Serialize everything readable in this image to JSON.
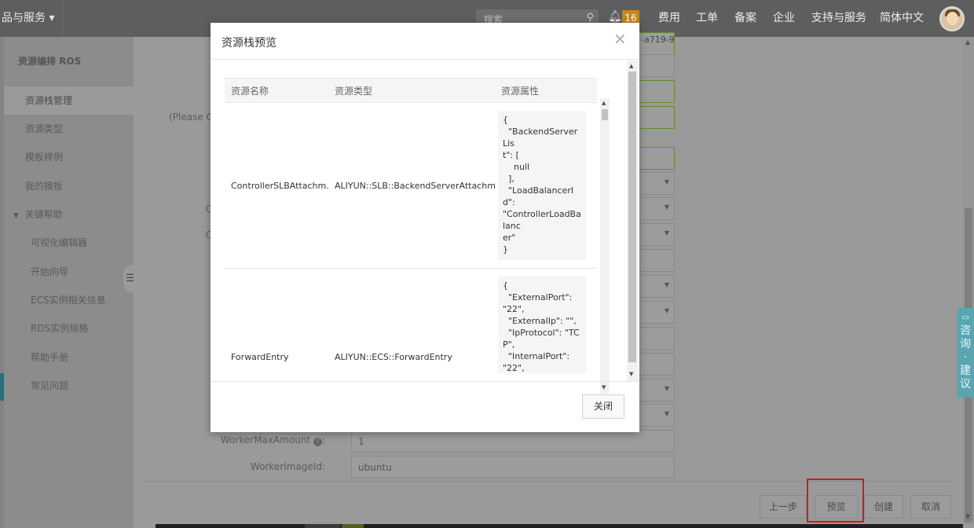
{
  "topbar": {
    "product_menu": "品与服务 ▾",
    "search_placeholder": "搜索",
    "notifications": "16",
    "nav": [
      "费用",
      "工单",
      "备案",
      "企业",
      "支持与服务",
      "简体中文"
    ]
  },
  "sidebar": {
    "title": "资源编排 ROS",
    "items": [
      "资源栈管理",
      "资源类型",
      "模板样例",
      "我的模板"
    ],
    "group": "关键帮助",
    "subitems": [
      "可视化编辑器",
      "开始向导",
      "ECS实例相关信息",
      "RDS实例规格",
      "帮助手册",
      "常见问题"
    ]
  },
  "form": {
    "hint_text": "(Please Co",
    "top_value": "-a719-9",
    "worker_max_label": "WorkerMaxAmount",
    "worker_max_value": "1",
    "worker_image_label": "WorkerImageId:",
    "worker_image_value": "ubuntu",
    "c_label_1": "C",
    "c_label_2": "C"
  },
  "footer": {
    "prev": "上一步",
    "preview": "预览",
    "create": "创建",
    "cancel": "取消"
  },
  "consult": [
    "咨",
    "询",
    "·",
    "建",
    "议"
  ],
  "modal": {
    "title": "资源栈预览",
    "close_icon": "×",
    "close_button": "关闭",
    "columns": [
      "资源名称",
      "资源类型",
      "资源属性"
    ],
    "rows": [
      {
        "name": "ControllerSLBAttachm...",
        "type": "ALIYUN::SLB::BackendServerAttachment",
        "props": "{\n  \"BackendServerLis\nt\": [\n    null\n  ],\n  \"LoadBalancerId\":\n\"ControllerLoadBalanc\ner\"\n}"
      },
      {
        "name": "ForwardEntry",
        "type": "ALIYUN::ECS::ForwardEntry",
        "props": "{\n  \"ExternalPort\": \"22\",\n  \"ExternalIp\": \"\",\n  \"IpProtocol\": \"TCP\",\n  \"InternalPort\": \"22\",\n  \"InternalIp\": \"\",\n  \"ForwardTableId\":\n\"\"\n}"
      }
    ]
  },
  "colors": {
    "highlight": "#cc1b1b",
    "badge": "#c8891d",
    "consult": "#59a6b2"
  }
}
